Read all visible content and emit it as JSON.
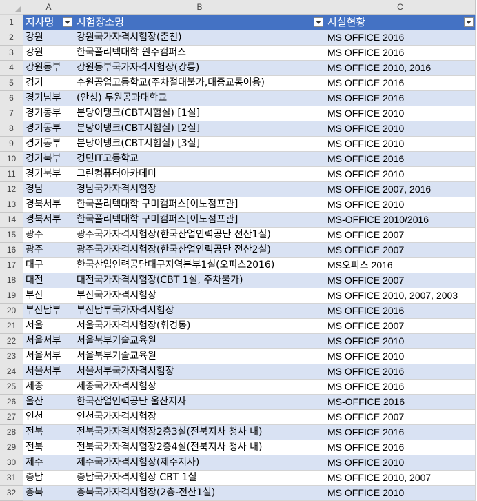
{
  "columns": [
    "A",
    "B",
    "C"
  ],
  "headers": {
    "a": "지사명",
    "b": "시험장소명",
    "c": "시설현황"
  },
  "rows": [
    {
      "n": "2",
      "a": "강원",
      "b": "강원국가자격시험장(춘천)",
      "c": "MS OFFICE 2016"
    },
    {
      "n": "3",
      "a": "강원",
      "b": "한국폴리텍대학 원주캠퍼스",
      "c": "MS OFFICE 2016"
    },
    {
      "n": "4",
      "a": "강원동부",
      "b": "강원동부국가자격시험장(강릉)",
      "c": "MS OFFICE 2010, 2016"
    },
    {
      "n": "5",
      "a": "경기",
      "b": "수원공업고등학교(주차절대불가,대중교통이용)",
      "c": "MS OFFICE 2016"
    },
    {
      "n": "6",
      "a": "경기남부",
      "b": "(안성) 두원공과대학교",
      "c": "MS OFFICE 2016"
    },
    {
      "n": "7",
      "a": "경기동부",
      "b": "분당이탱크(CBT시험실) [1실]",
      "c": "MS OFFICE 2010"
    },
    {
      "n": "8",
      "a": "경기동부",
      "b": "분당이탱크(CBT시험실) [2실]",
      "c": "MS OFFICE 2010"
    },
    {
      "n": "9",
      "a": "경기동부",
      "b": "분당이탱크(CBT시험실) [3실]",
      "c": "MS OFFICE 2010"
    },
    {
      "n": "10",
      "a": "경기북부",
      "b": "경민IT고등학교",
      "c": "MS OFFICE 2016"
    },
    {
      "n": "11",
      "a": "경기북부",
      "b": "그린컴퓨터아카데미",
      "c": "MS OFFICE 2010"
    },
    {
      "n": "12",
      "a": "경남",
      "b": "경남국가자격시험장",
      "c": "MS OFFICE 2007, 2016"
    },
    {
      "n": "13",
      "a": "경북서부",
      "b": "한국폴리텍대학 구미캠퍼스[이노점프관]",
      "c": "MS OFFICE 2010"
    },
    {
      "n": "14",
      "a": "경북서부",
      "b": "한국폴리텍대학 구미캠퍼스[이노점프관]",
      "c": "MS-OFFICE 2010/2016"
    },
    {
      "n": "15",
      "a": "광주",
      "b": "광주국가자격시험장(한국산업인력공단 전산1실)",
      "c": "MS OFFICE 2007"
    },
    {
      "n": "16",
      "a": "광주",
      "b": "광주국가자격시험장(한국산업인력공단 전산2실)",
      "c": "MS OFFICE 2007"
    },
    {
      "n": "17",
      "a": "대구",
      "b": "한국산업인력공단대구지역본부1실(오피스2016)",
      "c": "MS오피스 2016"
    },
    {
      "n": "18",
      "a": "대전",
      "b": "대전국가자격시험장(CBT 1실, 주차불가)",
      "c": "MS OFFICE 2007"
    },
    {
      "n": "19",
      "a": "부산",
      "b": "부산국가자격시험장",
      "c": "MS OFFICE 2010, 2007, 2003"
    },
    {
      "n": "20",
      "a": "부산남부",
      "b": "부산남부국가자격시험장",
      "c": "MS OFFICE 2016"
    },
    {
      "n": "21",
      "a": "서울",
      "b": "서울국가자격시험장(휘경동)",
      "c": "MS OFFICE 2007"
    },
    {
      "n": "22",
      "a": "서울서부",
      "b": "서울북부기술교육원",
      "c": "MS OFFICE 2010"
    },
    {
      "n": "23",
      "a": "서울서부",
      "b": "서울북부기술교육원",
      "c": "MS OFFICE 2010"
    },
    {
      "n": "24",
      "a": "서울서부",
      "b": "서울서부국가자격시험장",
      "c": "MS OFFICE 2016"
    },
    {
      "n": "25",
      "a": "세종",
      "b": "세종국가자격시험장",
      "c": "MS OFFICE 2016"
    },
    {
      "n": "26",
      "a": "울산",
      "b": "한국산업인력공단 울산지사",
      "c": "MS-OFFICE 2016"
    },
    {
      "n": "27",
      "a": "인천",
      "b": "인천국가자격시험장",
      "c": "MS OFFICE 2007"
    },
    {
      "n": "28",
      "a": "전북",
      "b": "전북국가자격시험장2층3실(전북지사 청사 내)",
      "c": "MS OFFICE 2016"
    },
    {
      "n": "29",
      "a": "전북",
      "b": "전북국가자격시험장2층4실(전북지사 청사 내)",
      "c": "MS OFFICE 2016"
    },
    {
      "n": "30",
      "a": "제주",
      "b": "제주국가자격시험장(제주지사)",
      "c": "MS OFFICE 2010"
    },
    {
      "n": "31",
      "a": "충남",
      "b": "충남국가자격시험장 CBT 1실",
      "c": "MS OFFICE 2010, 2007"
    },
    {
      "n": "32",
      "a": "충북",
      "b": "충북국가자격시험장(2층-전산1실)",
      "c": "MS OFFICE 2010"
    }
  ]
}
